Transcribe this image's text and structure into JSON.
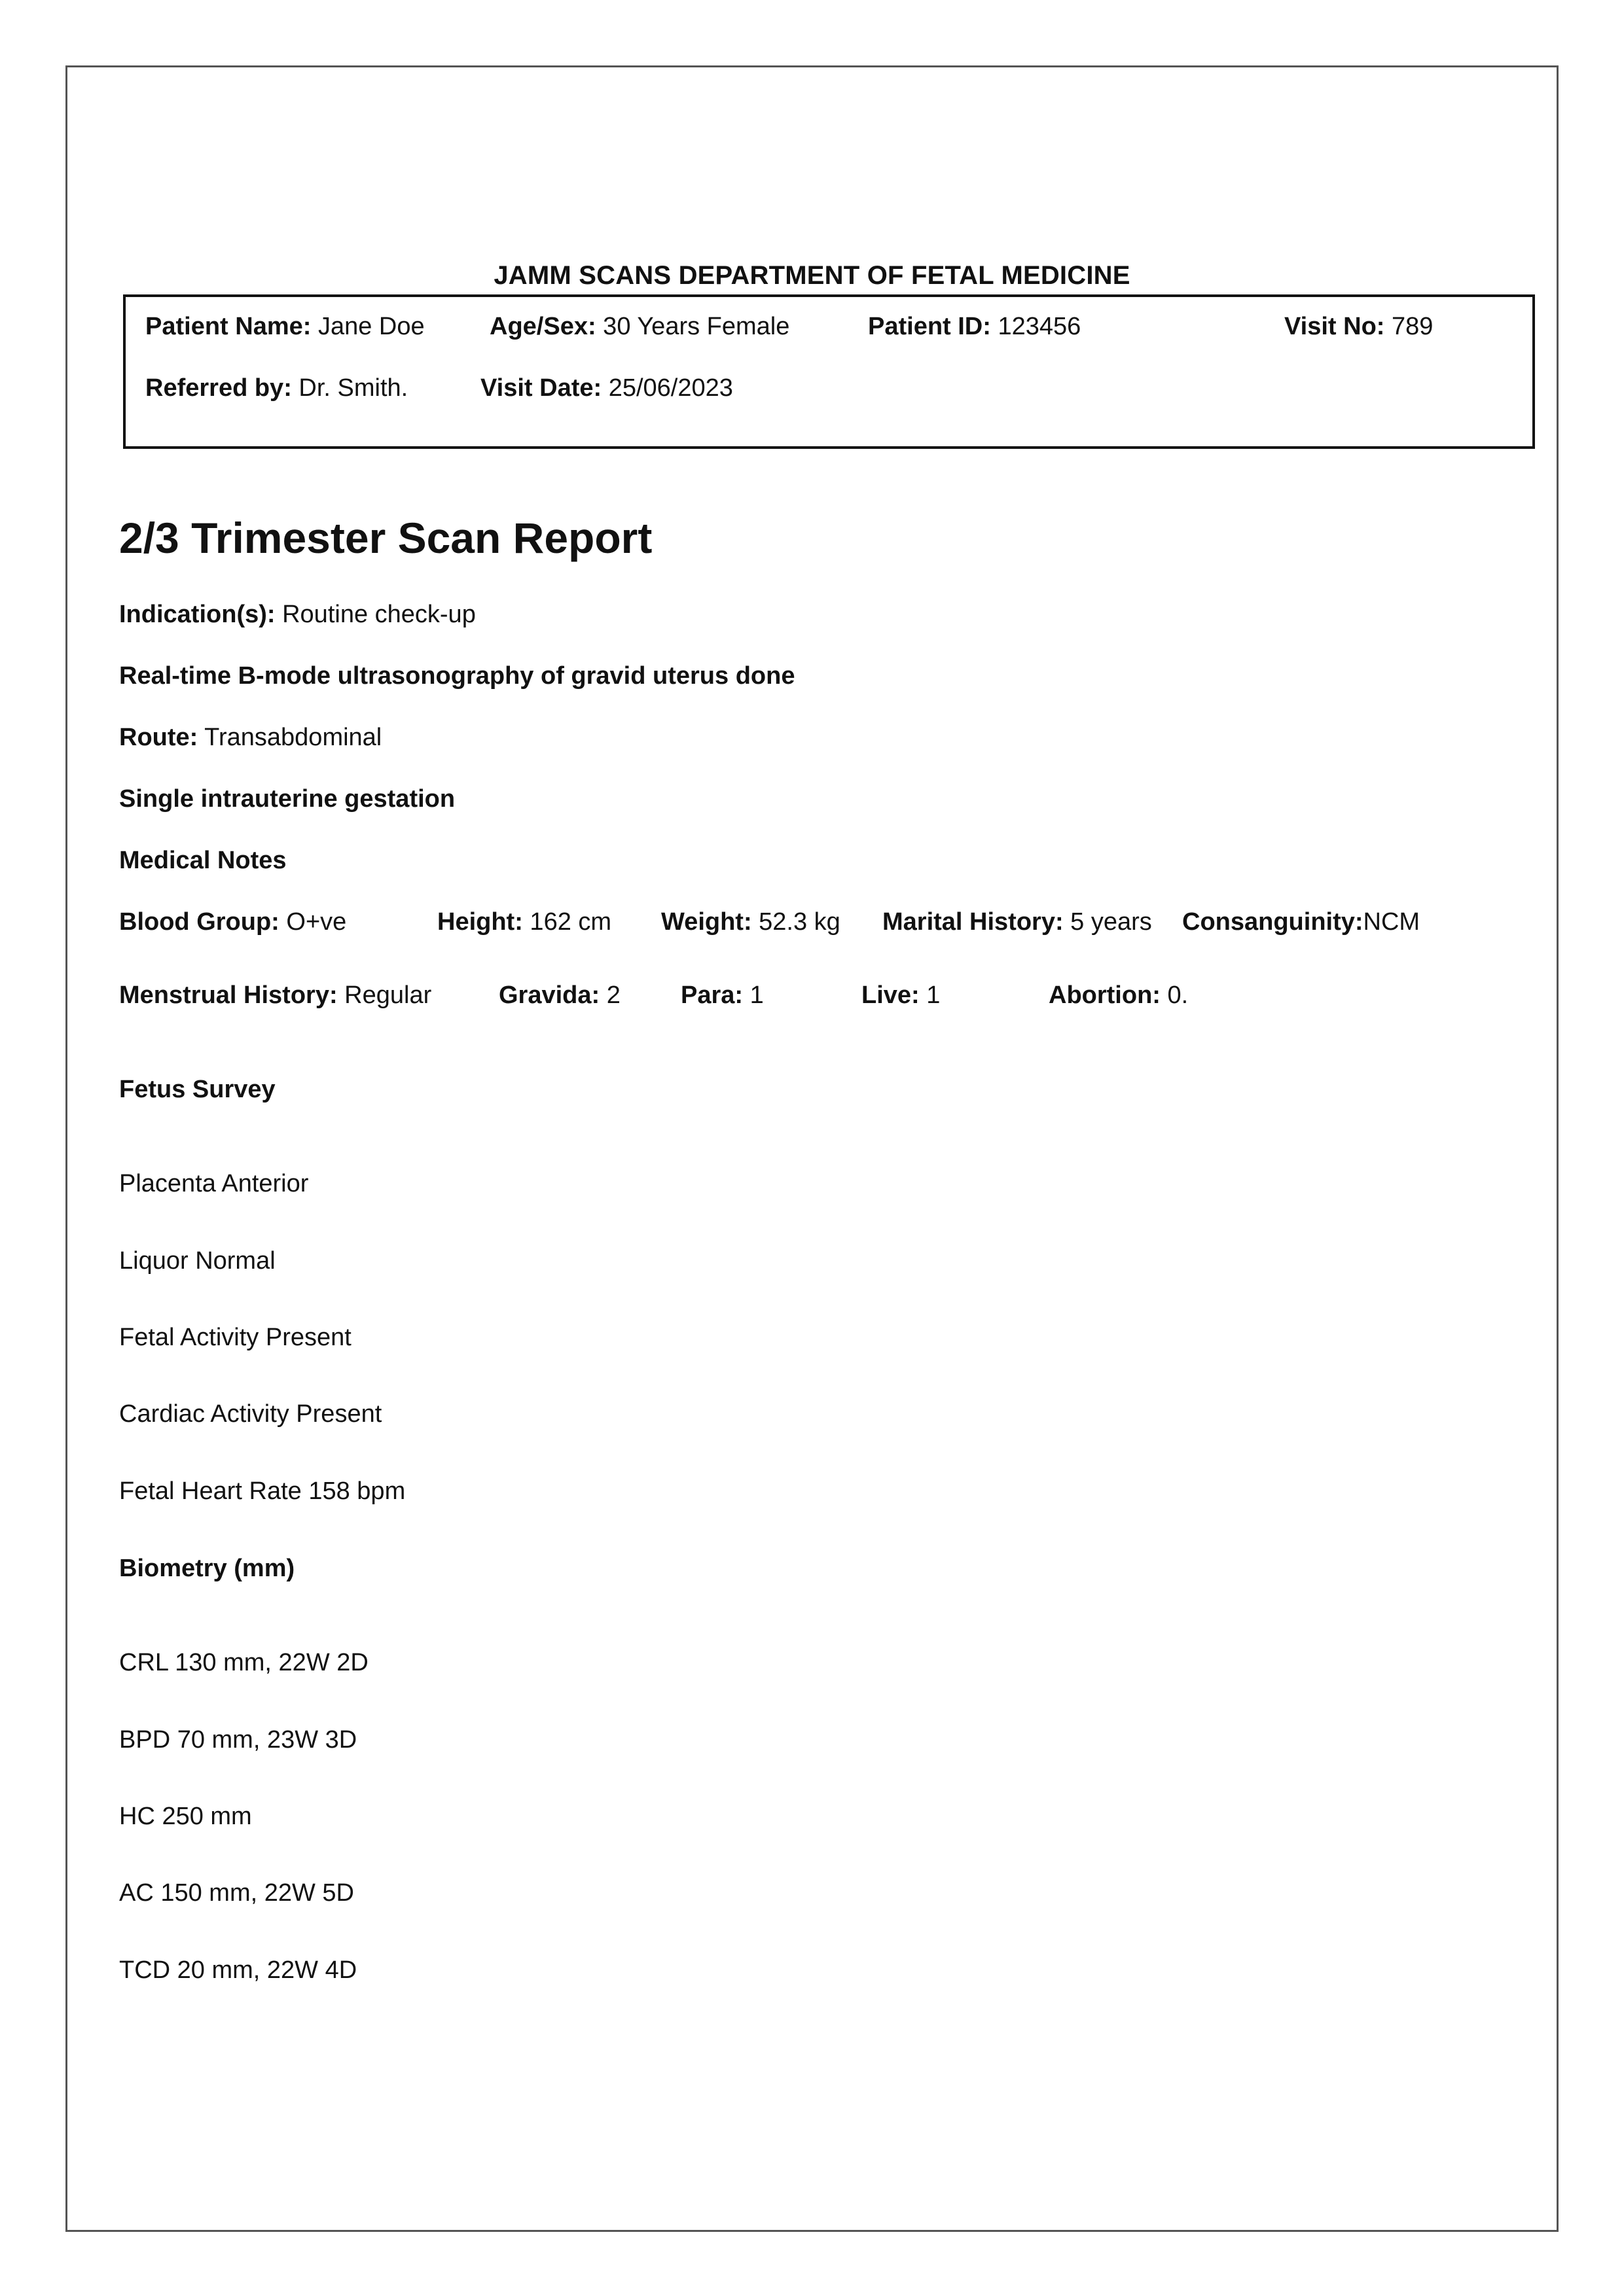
{
  "header": {
    "department": "JAMM SCANS DEPARTMENT OF FETAL MEDICINE"
  },
  "patient": {
    "name_label": "Patient Name:",
    "name_value": " Jane Doe",
    "age_label": "Age/Sex:",
    "age_value": " 30 Years Female",
    "id_label": "Patient ID:",
    "id_value": " 123456",
    "visit_no_label": "Visit No:",
    "visit_no_value": " 789",
    "referred_label": "Referred by:",
    "referred_value": " Dr. Smith.",
    "visit_date_label": "Visit Date:",
    "visit_date_value": " 25/06/2023"
  },
  "report": {
    "title": "2/3 Trimester Scan Report",
    "indication_label": "Indication(s):",
    "indication_value": " Routine check-up",
    "modality": "Real-time B-mode ultrasonography of gravid uterus done",
    "route_label": "Route:",
    "route_value": " Transabdominal",
    "gestation": "Single intrauterine gestation",
    "medical_notes_heading": "Medical Notes"
  },
  "medical": {
    "blood_group_label": "Blood Group:",
    "blood_group_value": " O+ve",
    "height_label": "Height:",
    "height_value": " 162 cm",
    "weight_label": "Weight:",
    "weight_value": " 52.3 kg",
    "marital_label": "Marital History:",
    "marital_value": " 5 years",
    "consanguinity_label": "Consanguinity:",
    "consanguinity_value": "NCM",
    "menstrual_label": "Menstrual History:",
    "menstrual_value": " Regular",
    "gravida_label": "Gravida:",
    "gravida_value": " 2",
    "para_label": "Para:",
    "para_value": " 1",
    "live_label": "Live:",
    "live_value": " 1",
    "abortion_label": "Abortion:",
    "abortion_value": " 0."
  },
  "fetus_survey": {
    "heading": "Fetus Survey",
    "items": [
      "Placenta Anterior",
      "Liquor Normal",
      "Fetal Activity  Present",
      "Cardiac Activity Present",
      "Fetal Heart Rate 158 bpm"
    ]
  },
  "biometry": {
    "heading": "Biometry (mm)",
    "items": [
      "CRL 130 mm, 22W 2D",
      "BPD 70 mm, 23W 3D",
      "HC 250 mm",
      "AC 150 mm, 22W 5D",
      "TCD 20 mm, 22W 4D"
    ]
  }
}
